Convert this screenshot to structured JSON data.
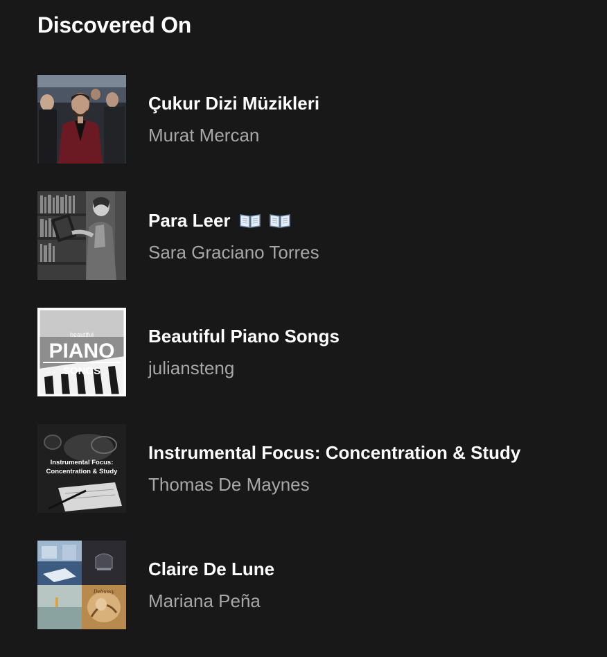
{
  "section": {
    "title": "Discovered On"
  },
  "playlists": [
    {
      "title": "Çukur Dizi Müzikleri",
      "owner": "Murat Mercan",
      "cover_icon": "group-portrait-cover"
    },
    {
      "title": "Para Leer",
      "title_icons": [
        "open-book-emoji",
        "open-book-emoji"
      ],
      "owner": "Sara Graciano Torres",
      "cover_icon": "woman-reading-cover"
    },
    {
      "title": "Beautiful Piano Songs",
      "owner": "juliansteng",
      "cover_icon": "piano-keys-cover",
      "cover_text": {
        "top": "beautiful",
        "main": "PIANO",
        "bottom": "SONGS"
      }
    },
    {
      "title": "Instrumental Focus: Concentration & Study",
      "owner": "Thomas De Maynes",
      "cover_icon": "desk-notebook-cover",
      "cover_text": {
        "line1": "Instrumental Focus:",
        "line2": "Concentration & Study"
      }
    },
    {
      "title": "Claire De Lune",
      "owner": "Mariana Peña",
      "cover_icon": "four-tile-mosaic-cover"
    }
  ],
  "colors": {
    "background": "#181818",
    "title": "#ffffff",
    "subtitle": "#a7a7a7"
  }
}
